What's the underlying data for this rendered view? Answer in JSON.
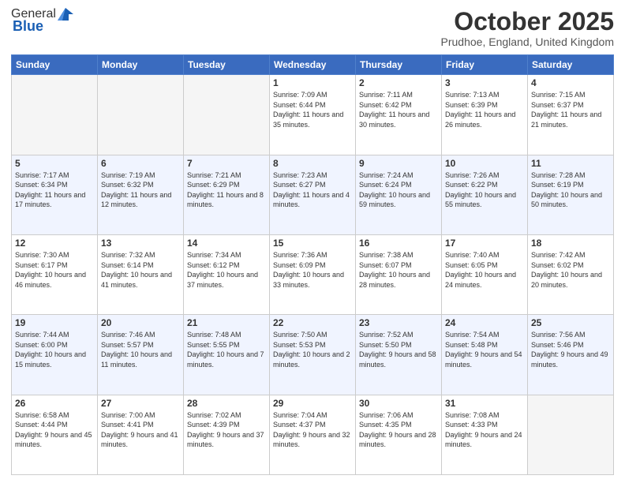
{
  "header": {
    "logo_general": "General",
    "logo_blue": "Blue",
    "month_title": "October 2025",
    "location": "Prudhoe, England, United Kingdom"
  },
  "days_of_week": [
    "Sunday",
    "Monday",
    "Tuesday",
    "Wednesday",
    "Thursday",
    "Friday",
    "Saturday"
  ],
  "weeks": [
    [
      {
        "day": "",
        "empty": true
      },
      {
        "day": "",
        "empty": true
      },
      {
        "day": "",
        "empty": true
      },
      {
        "day": "1",
        "sunrise": "Sunrise: 7:09 AM",
        "sunset": "Sunset: 6:44 PM",
        "daylight": "Daylight: 11 hours and 35 minutes."
      },
      {
        "day": "2",
        "sunrise": "Sunrise: 7:11 AM",
        "sunset": "Sunset: 6:42 PM",
        "daylight": "Daylight: 11 hours and 30 minutes."
      },
      {
        "day": "3",
        "sunrise": "Sunrise: 7:13 AM",
        "sunset": "Sunset: 6:39 PM",
        "daylight": "Daylight: 11 hours and 26 minutes."
      },
      {
        "day": "4",
        "sunrise": "Sunrise: 7:15 AM",
        "sunset": "Sunset: 6:37 PM",
        "daylight": "Daylight: 11 hours and 21 minutes."
      }
    ],
    [
      {
        "day": "5",
        "sunrise": "Sunrise: 7:17 AM",
        "sunset": "Sunset: 6:34 PM",
        "daylight": "Daylight: 11 hours and 17 minutes."
      },
      {
        "day": "6",
        "sunrise": "Sunrise: 7:19 AM",
        "sunset": "Sunset: 6:32 PM",
        "daylight": "Daylight: 11 hours and 12 minutes."
      },
      {
        "day": "7",
        "sunrise": "Sunrise: 7:21 AM",
        "sunset": "Sunset: 6:29 PM",
        "daylight": "Daylight: 11 hours and 8 minutes."
      },
      {
        "day": "8",
        "sunrise": "Sunrise: 7:23 AM",
        "sunset": "Sunset: 6:27 PM",
        "daylight": "Daylight: 11 hours and 4 minutes."
      },
      {
        "day": "9",
        "sunrise": "Sunrise: 7:24 AM",
        "sunset": "Sunset: 6:24 PM",
        "daylight": "Daylight: 10 hours and 59 minutes."
      },
      {
        "day": "10",
        "sunrise": "Sunrise: 7:26 AM",
        "sunset": "Sunset: 6:22 PM",
        "daylight": "Daylight: 10 hours and 55 minutes."
      },
      {
        "day": "11",
        "sunrise": "Sunrise: 7:28 AM",
        "sunset": "Sunset: 6:19 PM",
        "daylight": "Daylight: 10 hours and 50 minutes."
      }
    ],
    [
      {
        "day": "12",
        "sunrise": "Sunrise: 7:30 AM",
        "sunset": "Sunset: 6:17 PM",
        "daylight": "Daylight: 10 hours and 46 minutes."
      },
      {
        "day": "13",
        "sunrise": "Sunrise: 7:32 AM",
        "sunset": "Sunset: 6:14 PM",
        "daylight": "Daylight: 10 hours and 41 minutes."
      },
      {
        "day": "14",
        "sunrise": "Sunrise: 7:34 AM",
        "sunset": "Sunset: 6:12 PM",
        "daylight": "Daylight: 10 hours and 37 minutes."
      },
      {
        "day": "15",
        "sunrise": "Sunrise: 7:36 AM",
        "sunset": "Sunset: 6:09 PM",
        "daylight": "Daylight: 10 hours and 33 minutes."
      },
      {
        "day": "16",
        "sunrise": "Sunrise: 7:38 AM",
        "sunset": "Sunset: 6:07 PM",
        "daylight": "Daylight: 10 hours and 28 minutes."
      },
      {
        "day": "17",
        "sunrise": "Sunrise: 7:40 AM",
        "sunset": "Sunset: 6:05 PM",
        "daylight": "Daylight: 10 hours and 24 minutes."
      },
      {
        "day": "18",
        "sunrise": "Sunrise: 7:42 AM",
        "sunset": "Sunset: 6:02 PM",
        "daylight": "Daylight: 10 hours and 20 minutes."
      }
    ],
    [
      {
        "day": "19",
        "sunrise": "Sunrise: 7:44 AM",
        "sunset": "Sunset: 6:00 PM",
        "daylight": "Daylight: 10 hours and 15 minutes."
      },
      {
        "day": "20",
        "sunrise": "Sunrise: 7:46 AM",
        "sunset": "Sunset: 5:57 PM",
        "daylight": "Daylight: 10 hours and 11 minutes."
      },
      {
        "day": "21",
        "sunrise": "Sunrise: 7:48 AM",
        "sunset": "Sunset: 5:55 PM",
        "daylight": "Daylight: 10 hours and 7 minutes."
      },
      {
        "day": "22",
        "sunrise": "Sunrise: 7:50 AM",
        "sunset": "Sunset: 5:53 PM",
        "daylight": "Daylight: 10 hours and 2 minutes."
      },
      {
        "day": "23",
        "sunrise": "Sunrise: 7:52 AM",
        "sunset": "Sunset: 5:50 PM",
        "daylight": "Daylight: 9 hours and 58 minutes."
      },
      {
        "day": "24",
        "sunrise": "Sunrise: 7:54 AM",
        "sunset": "Sunset: 5:48 PM",
        "daylight": "Daylight: 9 hours and 54 minutes."
      },
      {
        "day": "25",
        "sunrise": "Sunrise: 7:56 AM",
        "sunset": "Sunset: 5:46 PM",
        "daylight": "Daylight: 9 hours and 49 minutes."
      }
    ],
    [
      {
        "day": "26",
        "sunrise": "Sunrise: 6:58 AM",
        "sunset": "Sunset: 4:44 PM",
        "daylight": "Daylight: 9 hours and 45 minutes."
      },
      {
        "day": "27",
        "sunrise": "Sunrise: 7:00 AM",
        "sunset": "Sunset: 4:41 PM",
        "daylight": "Daylight: 9 hours and 41 minutes."
      },
      {
        "day": "28",
        "sunrise": "Sunrise: 7:02 AM",
        "sunset": "Sunset: 4:39 PM",
        "daylight": "Daylight: 9 hours and 37 minutes."
      },
      {
        "day": "29",
        "sunrise": "Sunrise: 7:04 AM",
        "sunset": "Sunset: 4:37 PM",
        "daylight": "Daylight: 9 hours and 32 minutes."
      },
      {
        "day": "30",
        "sunrise": "Sunrise: 7:06 AM",
        "sunset": "Sunset: 4:35 PM",
        "daylight": "Daylight: 9 hours and 28 minutes."
      },
      {
        "day": "31",
        "sunrise": "Sunrise: 7:08 AM",
        "sunset": "Sunset: 4:33 PM",
        "daylight": "Daylight: 9 hours and 24 minutes."
      },
      {
        "day": "",
        "empty": true
      }
    ]
  ]
}
